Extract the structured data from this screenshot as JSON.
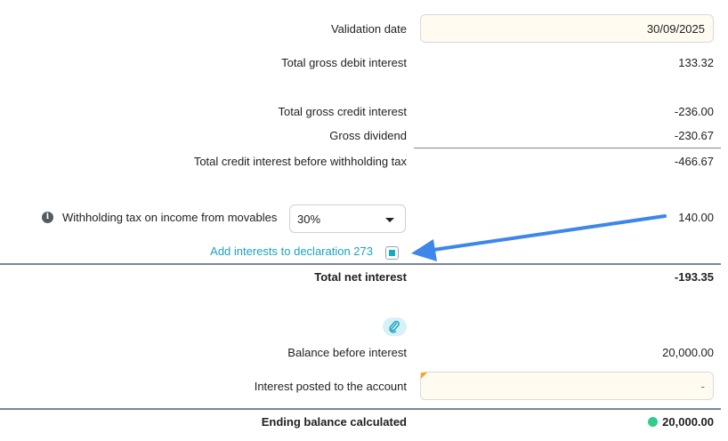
{
  "validation_date": {
    "label": "Validation date",
    "value": "30/09/2025"
  },
  "gross_debit_interest": {
    "label": "Total gross debit interest",
    "value": "133.32"
  },
  "gross_credit_interest": {
    "label": "Total gross credit interest",
    "value": "-236.00"
  },
  "gross_dividend": {
    "label": "Gross dividend",
    "value": "-230.67"
  },
  "credit_before_tax": {
    "label": "Total credit interest before withholding tax",
    "value": "-466.67"
  },
  "withholding_tax": {
    "label": "Withholding tax on income from movables",
    "rate": "30%",
    "value": "140.00",
    "icon": "info-icon"
  },
  "declaration": {
    "link": "Add interests to declaration 273",
    "checked": true
  },
  "total_net_interest": {
    "label": "Total net interest",
    "value": "-193.35"
  },
  "attachment": {
    "icon": "paperclip-icon"
  },
  "balance_before": {
    "label": "Balance before interest",
    "value": "20,000.00"
  },
  "interest_posted": {
    "label": "Interest posted to the account",
    "value": "-"
  },
  "ending_balance": {
    "label": "Ending balance calculated",
    "value": "20,000.00",
    "status_color": "#2fcc8b"
  },
  "colors": {
    "accent": "#1aa3c3",
    "annotation_arrow": "#3d86ea",
    "field_bg": "#fffbf0"
  }
}
